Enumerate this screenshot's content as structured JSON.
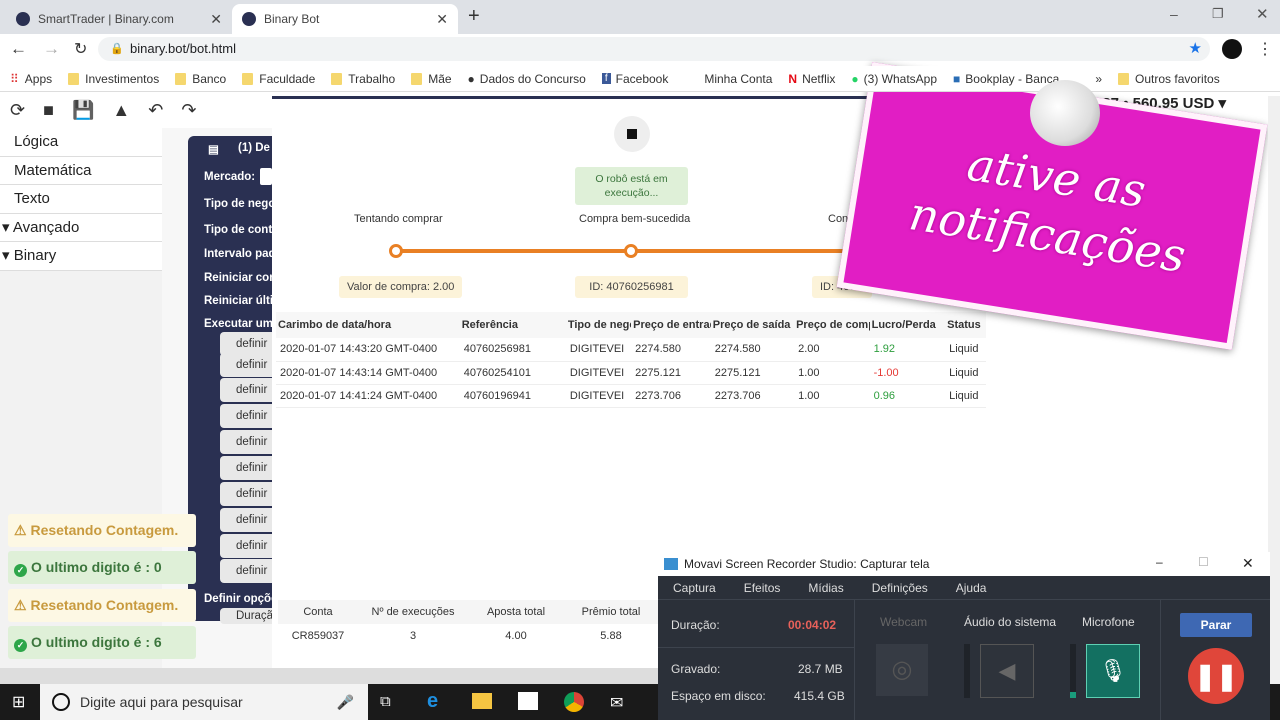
{
  "browser": {
    "tabs": [
      {
        "title": "SmartTrader | Binary.com",
        "active": false
      },
      {
        "title": "Binary Bot",
        "active": true
      }
    ],
    "url": "binary.bot/bot.html",
    "bookmarks": [
      "Apps",
      "Investimentos",
      "Banco",
      "Faculdade",
      "Trabalho",
      "Mãe",
      "Dados do Concurso",
      "Facebook",
      "Minha Conta",
      "Netflix",
      "(3) WhatsApp",
      "Bookplay - Banca",
      "»",
      "Outros favoritos"
    ]
  },
  "sidebar": {
    "items": [
      {
        "label": "Lógica"
      },
      {
        "label": "Matemática"
      },
      {
        "label": "Texto"
      },
      {
        "label": "▾ Avançado"
      },
      {
        "label": "▾ Binary"
      }
    ]
  },
  "block": {
    "title": "(1) De",
    "rows": [
      "Mercado:",
      "Tipo de nego",
      "Tipo de contr",
      "Intervalo pad",
      "Reiniciar con",
      "Reiniciar últi",
      "Executar uma"
    ],
    "define_label": "definir",
    "options_label": "Definir opçõe",
    "duration_label": "Duraçã"
  },
  "account": {
    "balance": "037 • 560,95 USD ▾"
  },
  "bot": {
    "status": "O robô está em execução...",
    "steps": [
      {
        "label": "Tentando comprar",
        "tip": "Valor de compra: 2.00"
      },
      {
        "label": "Compra bem-sucedida",
        "tip": "ID: 40760256981"
      },
      {
        "label": "Conf",
        "tip": "ID: 407"
      }
    ]
  },
  "trades": {
    "headers": [
      "Carimbo de data/hora",
      "Referência",
      "Tipo de nego",
      "Preço de entrad",
      "Preço de saída",
      "Preço de comp",
      "Lucro/Perda",
      "Status"
    ],
    "rows": [
      [
        "2020-01-07 14:43:20 GMT-0400",
        "40760256981",
        "DIGITEVEI",
        "2274.580",
        "2274.580",
        "2.00",
        "1.92",
        "Liquid"
      ],
      [
        "2020-01-07 14:43:14 GMT-0400",
        "40760254101",
        "DIGITEVEI",
        "2275.121",
        "2275.121",
        "1.00",
        "-1.00",
        "Liquid"
      ],
      [
        "2020-01-07 14:41:24 GMT-0400",
        "40760196941",
        "DIGITEVEI",
        "2273.706",
        "2273.706",
        "1.00",
        "0.96",
        "Liquid"
      ]
    ]
  },
  "summary": {
    "headers": [
      "Conta",
      "Nº de execuções",
      "Aposta total",
      "Prêmio total"
    ],
    "values": [
      "CR859037",
      "3",
      "4.00",
      "5.88"
    ]
  },
  "notifications": [
    {
      "type": "warning",
      "text": "Resetando Contagem."
    },
    {
      "type": "success",
      "text": "O ultimo digito é : 0"
    },
    {
      "type": "warning",
      "text": "Resetando Contagem."
    },
    {
      "type": "success",
      "text": "O ultimo digito é : 6"
    }
  ],
  "sticker": {
    "line1": "ative as",
    "line2": "notificações",
    "color": "#e11ec4"
  },
  "recorder": {
    "title": "Movavi Screen Recorder Studio: Capturar tela",
    "menu": [
      "Captura",
      "Efeitos",
      "Mídias",
      "Definições",
      "Ajuda"
    ],
    "duration_label": "Duração:",
    "duration": "00:04:02",
    "recorded_label": "Gravado:",
    "recorded": "28.7 MB",
    "disk_label": "Espaço em disco:",
    "disk": "415.4 GB",
    "webcam": "Webcam",
    "system_audio": "Áudio do sistema",
    "mic": "Microfone",
    "stop": "Parar"
  },
  "taskbar": {
    "search_placeholder": "Digite aqui para pesquisar"
  }
}
